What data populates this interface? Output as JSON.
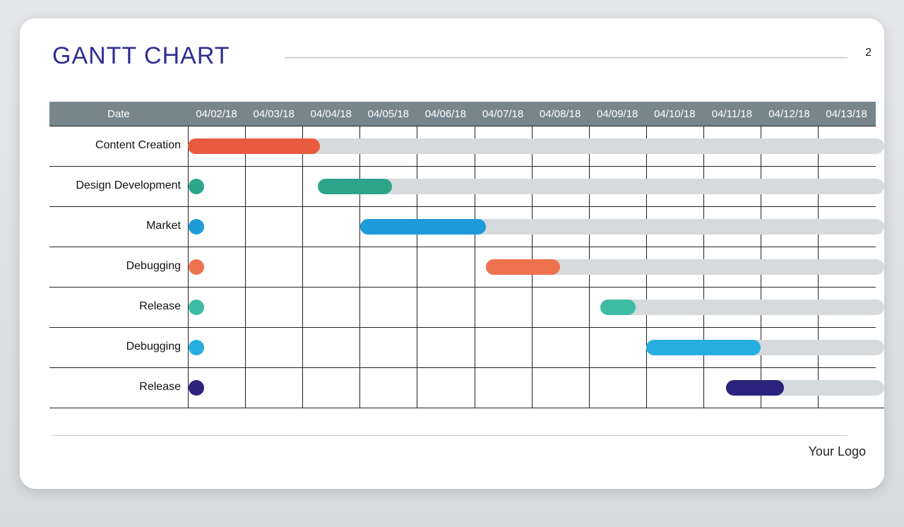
{
  "title": "GANTT CHART",
  "page_number": "2",
  "footer": {
    "logo_text": "Your Logo"
  },
  "header_label": "Date",
  "dates": [
    "04/02/18",
    "04/03/18",
    "04/04/18",
    "04/05/18",
    "04/06/18",
    "04/07/18",
    "04/08/18",
    "04/09/18",
    "04/10/18",
    "04/11/18",
    "04/12/18",
    "04/13/18"
  ],
  "tasks": [
    {
      "label": "Content Creation",
      "color": "#e85b3e"
    },
    {
      "label": "Design Development",
      "color": "#2da58a"
    },
    {
      "label": "Market",
      "color": "#1e9bd9"
    },
    {
      "label": "Debugging",
      "color": "#ed734f"
    },
    {
      "label": "Release",
      "color": "#3ebba3"
    },
    {
      "label": "Debugging",
      "color": "#27aee0"
    },
    {
      "label": "Release",
      "color": "#2c237d"
    }
  ],
  "chart_data": {
    "type": "gantt",
    "title": "GANTT CHART",
    "x_categories": [
      "04/02/18",
      "04/03/18",
      "04/04/18",
      "04/05/18",
      "04/06/18",
      "04/07/18",
      "04/08/18",
      "04/09/18",
      "04/10/18",
      "04/11/18",
      "04/12/18",
      "04/13/18"
    ],
    "series": [
      {
        "name": "Content Creation",
        "start": "04/02/18",
        "end": "04/04/18",
        "start_idx": 0,
        "span": 2.3,
        "color": "#e85b3e",
        "marker": false
      },
      {
        "name": "Design Development",
        "start": "04/04/18",
        "end": "04/05/18",
        "start_idx": 2.3,
        "span": 1.3,
        "color": "#2da58a",
        "marker": true
      },
      {
        "name": "Market",
        "start": "04/05/18",
        "end": "04/07/18",
        "start_idx": 3.0,
        "span": 2.2,
        "color": "#1e9bd9",
        "marker": true
      },
      {
        "name": "Debugging",
        "start": "04/07/18",
        "end": "04/08/18",
        "start_idx": 5.2,
        "span": 1.3,
        "color": "#ed734f",
        "marker": true
      },
      {
        "name": "Release",
        "start": "04/09/18",
        "end": "04/09/18",
        "start_idx": 7.2,
        "span": 0.6,
        "color": "#3ebba3",
        "marker": true
      },
      {
        "name": "Debugging",
        "start": "04/10/18",
        "end": "04/11/18",
        "start_idx": 8.0,
        "span": 2.0,
        "color": "#27aee0",
        "marker": true
      },
      {
        "name": "Release",
        "start": "04/11/18",
        "end": "04/12/18",
        "start_idx": 9.4,
        "span": 1.0,
        "color": "#2c237d",
        "marker": true
      }
    ],
    "xlabel": "Date",
    "ylabel": ""
  }
}
